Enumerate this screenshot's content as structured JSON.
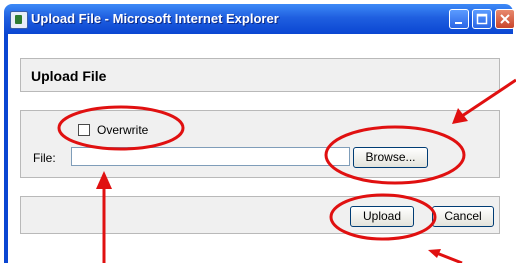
{
  "window": {
    "title": "Upload File - Microsoft Internet Explorer"
  },
  "form": {
    "heading": "Upload File",
    "overwrite_label": "Overwrite",
    "overwrite_checked": false,
    "file_label": "File:",
    "file_value": "",
    "browse_label": "Browse...",
    "upload_label": "Upload",
    "cancel_label": "Cancel"
  },
  "annotation": {
    "color": "#e01010"
  }
}
